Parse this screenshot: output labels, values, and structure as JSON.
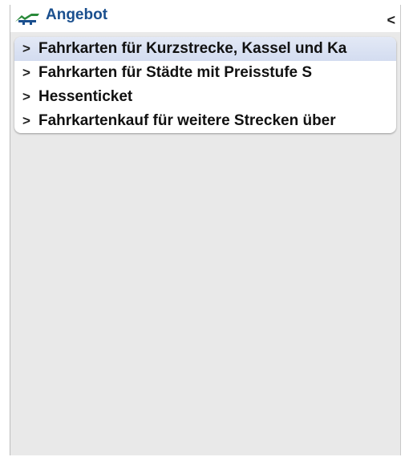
{
  "header": {
    "title": "Angebot",
    "logo_icon": "train-logo-icon",
    "back_symbol": "<",
    "brand_color": "#1a4f8e"
  },
  "menu": {
    "items": [
      {
        "chevron": ">",
        "label": "Fahrkarten für Kurzstrecke, Kassel und Ka",
        "selected": true
      },
      {
        "chevron": ">",
        "label": "Fahrkarten für Städte mit Preisstufe S",
        "selected": false
      },
      {
        "chevron": ">",
        "label": "Hessenticket",
        "selected": false
      },
      {
        "chevron": ">",
        "label": "Fahrkartenkauf für weitere Strecken über",
        "selected": false
      }
    ]
  }
}
